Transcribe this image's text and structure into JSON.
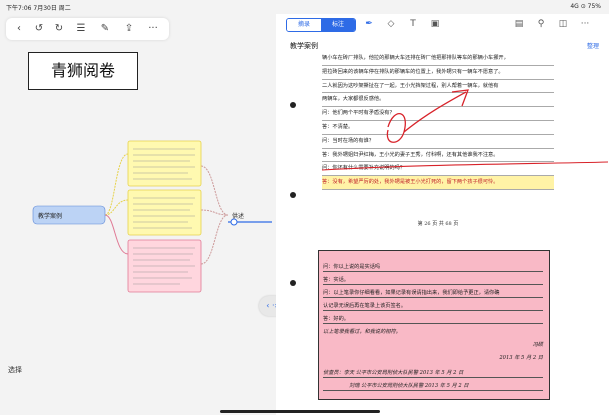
{
  "status_bar": {
    "left": "下午7:06  7月30日 周二",
    "right": "4G ⊙ 75%"
  },
  "toolbar": {
    "icons": [
      "chevron-left-icon",
      "undo-icon",
      "redo-icon",
      "list-icon",
      "edit-icon",
      "share-icon",
      "more-icon"
    ],
    "glyphs": [
      "‹",
      "↺",
      "↻",
      "☰",
      "✎",
      "⇪",
      "···"
    ]
  },
  "title_text": "青狮阅卷",
  "mindmap": {
    "root": "教学案例",
    "branch": "供述",
    "colors": {
      "yellow": "#fff9b0",
      "yellow_border": "#e6d24a",
      "pink": "#ffd6de",
      "pink_border": "#e07a95",
      "root": "#bcd3f5",
      "root_border": "#5b86d6"
    }
  },
  "select_label": "选择",
  "divider_label": "‹ ·›",
  "right_toolbar": {
    "seg_left": "摘录",
    "seg_right": "标注",
    "icons": [
      "pen-icon",
      "eraser-icon",
      "text-icon",
      "image-icon",
      "doc-icon",
      "search-icon",
      "bookmark-icon",
      "more-icon"
    ],
    "glyphs": [
      "✒",
      "◇",
      "T",
      "▣",
      "▤",
      "⚲",
      "◫",
      "···"
    ]
  },
  "doc_title": "教学案例",
  "doc_manage": "整理",
  "page_lines": [
    "辆小车在砖厂排队，他拉的那辆大车还排在砖厂他把那排队等车的那辆小车挪开，",
    "把拉砖回来的该辆车停在排队的那辆车的位置上，我外甥只有一辆车不愿意了。",
    "二人就因为这吵架撕扯在了一起，王小光挡架过程，别人帮着一辆车，就他有",
    "两辆车，大家都很反感他。",
    "问：他们两个平时有矛盾没有？",
    "答：不清楚。",
    "问：当时在场的有谁？",
    "答：我外甥姐妇尹红梅，王小光的妻子王秀，付科啊，还有其他谁我不注意。",
    "问：你还有什么需要补充说明的吗？",
    "答：没有，希望严厉的处，我外甥是被王小光打死的，留下两个孩子很可怜。"
  ],
  "page_number": "第 26 页 共 68 页",
  "pink_lines": [
    "问：你以上说的是实话吗",
    "答：实话。",
    "问：以上笔录你仔细看看，如果记录有误请指出来，我们即给予更正，请你确",
    "认记录无误后再在笔录上该页签名。",
    "答：好的。",
    "以上笔录我看过，和我说的相符。"
  ],
  "pink_sign": "冯硕",
  "pink_date1": "2013 年 5 月 2 日",
  "pink_interrogator1": "侦查员：李天      公平市公安局刑侦大队民警        2013 年 5 月 2 日",
  "pink_interrogator2": "刘瑞      公平市公安局刑侦大队民警        2013 年 5 月 2 日"
}
